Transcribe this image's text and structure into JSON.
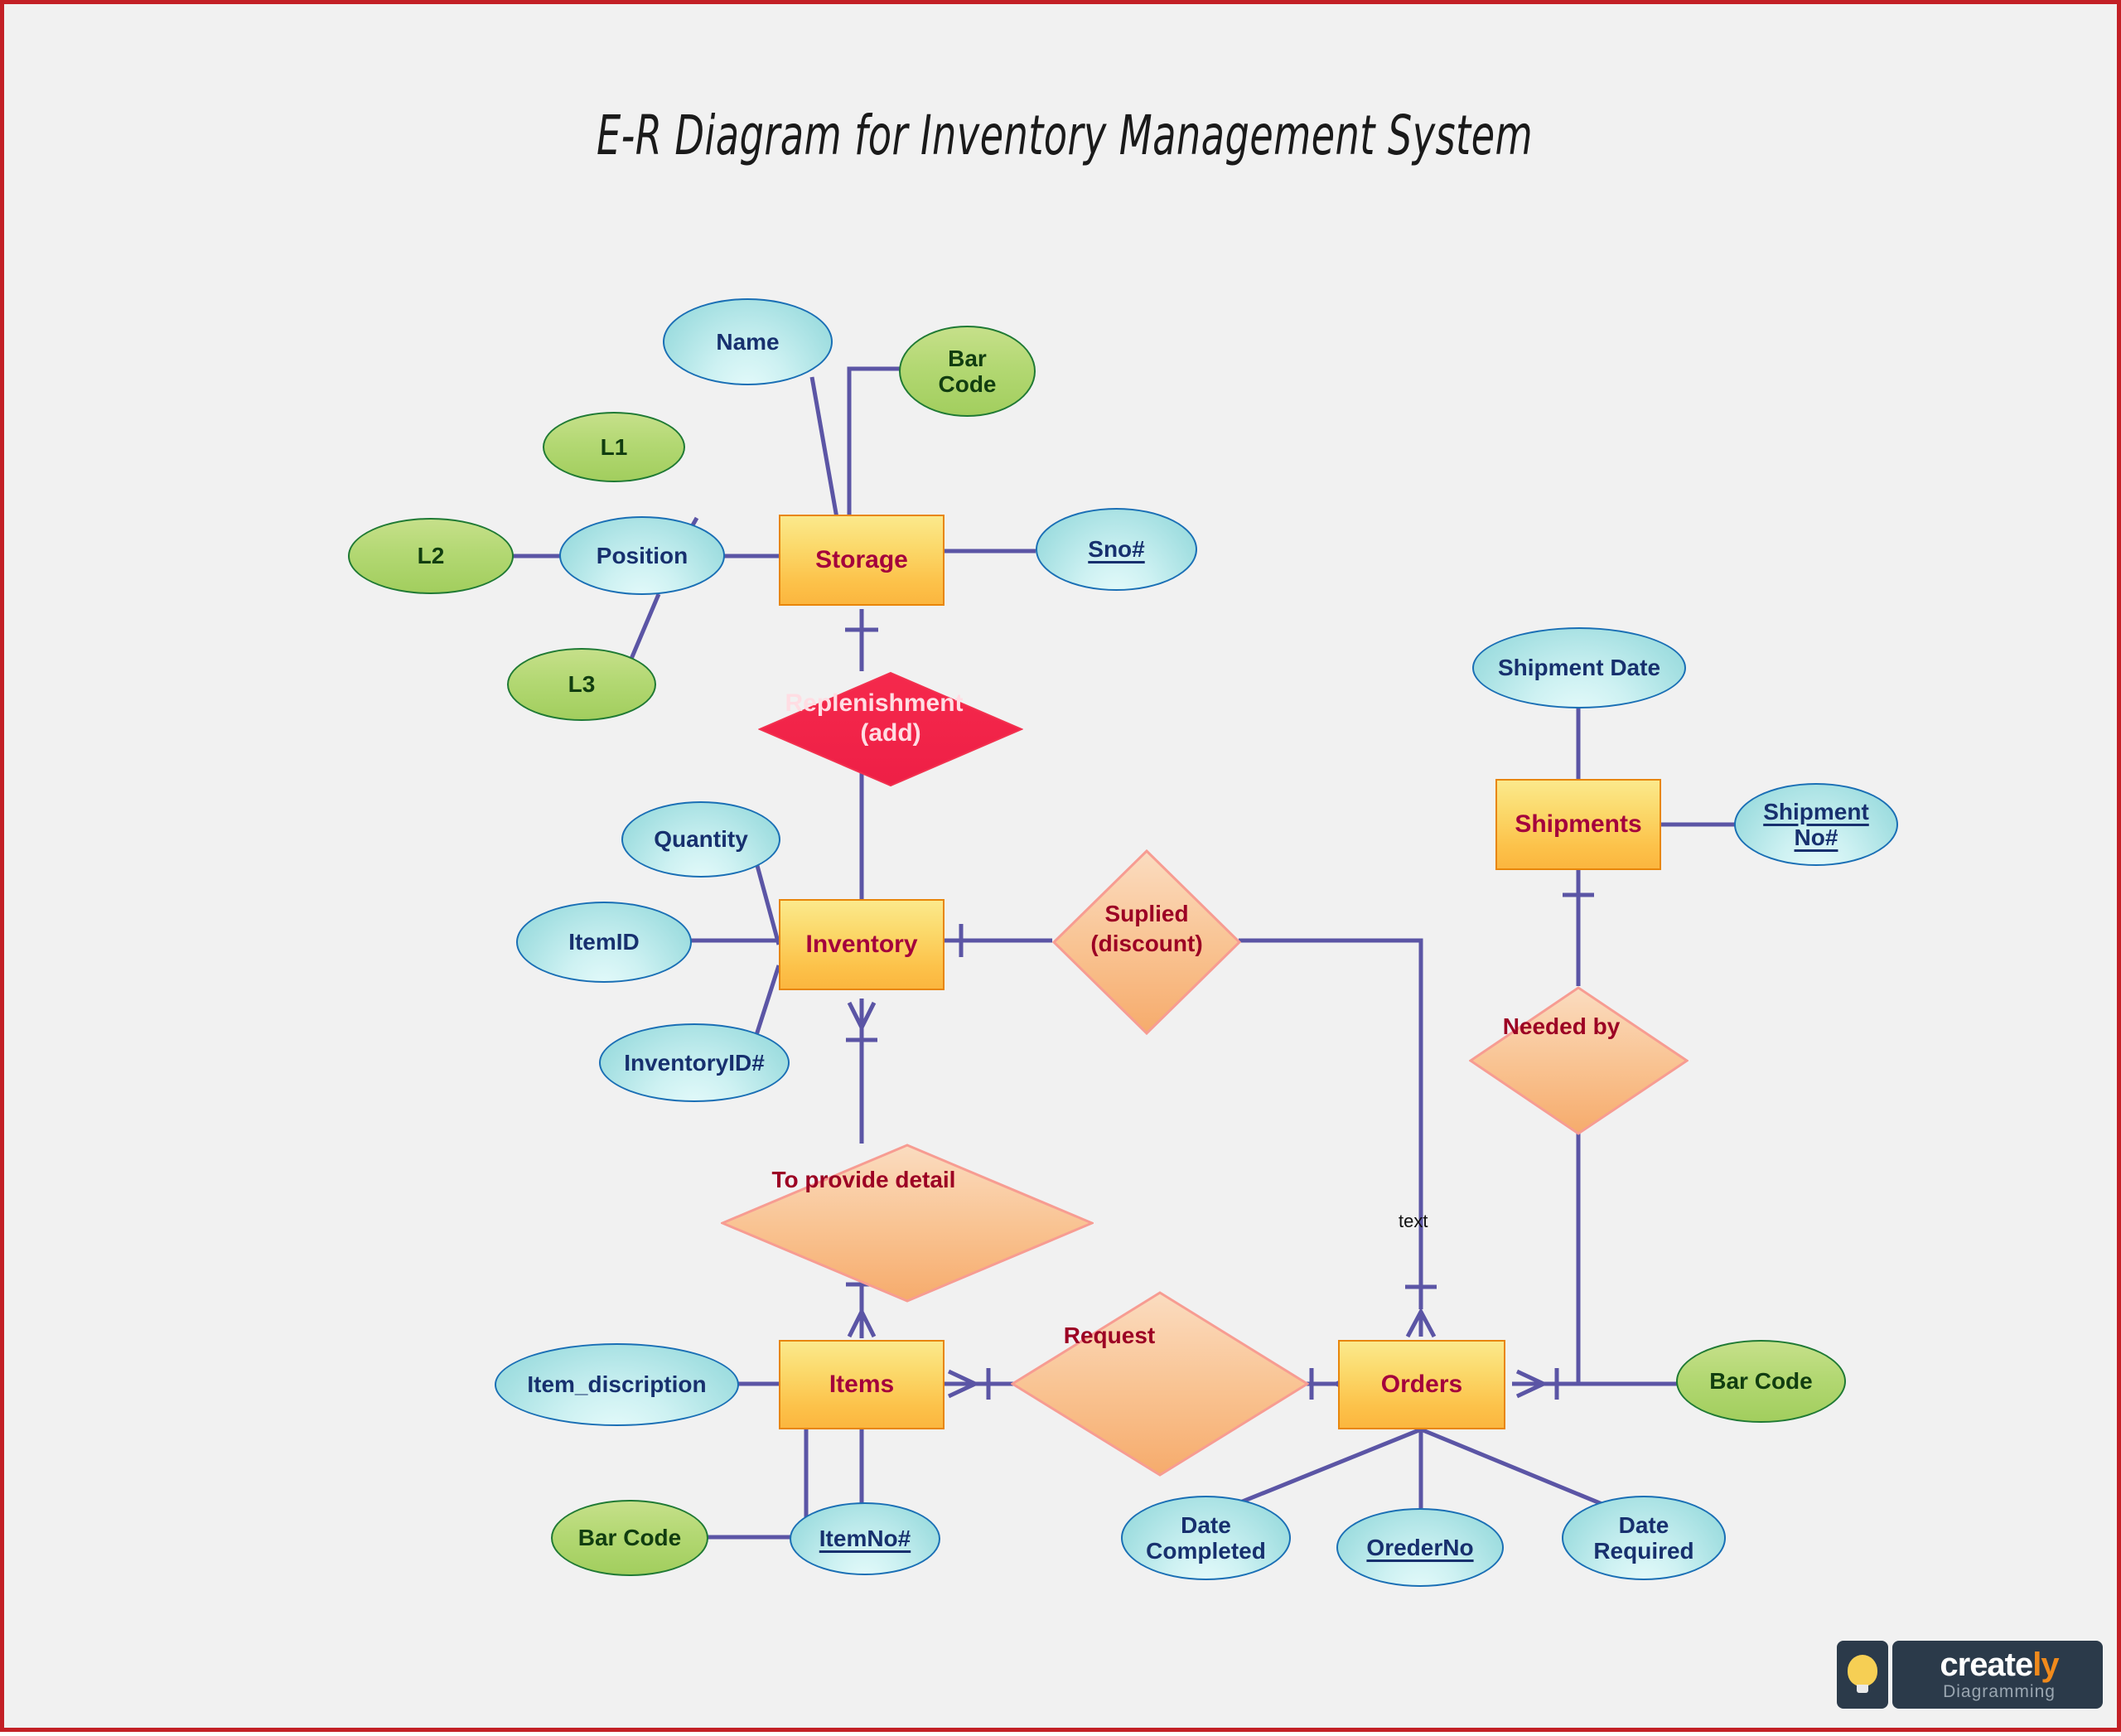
{
  "page": {
    "title": "E-R Diagram for Inventory Management System",
    "background_color": "#f1f1f1",
    "border_color": "#c32026"
  },
  "colors": {
    "entity_fill": "#fbc94e",
    "entity_border": "#e8860a",
    "entity_text": "#a4003c",
    "attribute_blue_fill": "#a8e2e4",
    "attribute_blue_border": "#1a6fb5",
    "attribute_blue_text": "#17306e",
    "attribute_green_fill": "#aed470",
    "attribute_green_border": "#1f7a34",
    "attribute_green_text": "#113d10",
    "relationship_peach_fill": "#f8c08a",
    "relationship_peach_border": "#f79c92",
    "relationship_peach_text": "#9c0024",
    "relationship_red_fill": "#f2314f",
    "relationship_red_text": "#ffdde3",
    "connector": "#5b55a5"
  },
  "entities": [
    {
      "id": "storage",
      "label": "Storage"
    },
    {
      "id": "inventory",
      "label": "Inventory"
    },
    {
      "id": "items",
      "label": "Items"
    },
    {
      "id": "orders",
      "label": "Orders"
    },
    {
      "id": "shipments",
      "label": "Shipments"
    }
  ],
  "relationships": [
    {
      "id": "replenishment",
      "label_line1": "Replenishment",
      "label_line2": "(add)",
      "style": "red"
    },
    {
      "id": "suplied",
      "label_line1": "Suplied",
      "label_line2": "(discount)",
      "style": "peach"
    },
    {
      "id": "provide-detail",
      "label_line1": "To provide detail",
      "label_line2": "",
      "style": "peach"
    },
    {
      "id": "request",
      "label_line1": "Request",
      "label_line2": "",
      "style": "peach"
    },
    {
      "id": "needed-by",
      "label_line1": "Needed by",
      "label_line2": "",
      "style": "peach"
    }
  ],
  "attributes": [
    {
      "id": "name",
      "label": "Name",
      "style": "blue",
      "key": false
    },
    {
      "id": "bar-code-storage",
      "label": "Bar\nCode",
      "style": "green",
      "key": false
    },
    {
      "id": "sno",
      "label": "Sno#",
      "style": "blue",
      "key": true
    },
    {
      "id": "position",
      "label": "Position",
      "style": "blue",
      "key": false
    },
    {
      "id": "l1",
      "label": "L1",
      "style": "green",
      "key": false
    },
    {
      "id": "l2",
      "label": "L2",
      "style": "green",
      "key": false
    },
    {
      "id": "l3",
      "label": "L3",
      "style": "green",
      "key": false
    },
    {
      "id": "quantity",
      "label": "Quantity",
      "style": "blue",
      "key": false
    },
    {
      "id": "item-id",
      "label": "ItemID",
      "style": "blue",
      "key": false
    },
    {
      "id": "inventory-id",
      "label": "InventoryID#",
      "style": "blue",
      "key": false
    },
    {
      "id": "item-discription",
      "label": "Item_discription",
      "style": "blue",
      "key": false
    },
    {
      "id": "bar-code-items",
      "label": "Bar Code",
      "style": "green",
      "key": false
    },
    {
      "id": "item-no",
      "label": "ItemNo#",
      "style": "blue",
      "key": true
    },
    {
      "id": "date-completed",
      "label": "Date\nCompleted",
      "style": "blue",
      "key": false
    },
    {
      "id": "oreder-no",
      "label": "OrederNo",
      "style": "blue",
      "key": true
    },
    {
      "id": "date-required",
      "label": "Date\nRequired",
      "style": "blue",
      "key": false
    },
    {
      "id": "bar-code-orders",
      "label": "Bar Code",
      "style": "green",
      "key": false
    },
    {
      "id": "shipment-date",
      "label": "Shipment Date",
      "style": "blue",
      "key": false
    },
    {
      "id": "shipment-no",
      "label": "Shipment\nNo#",
      "style": "blue",
      "key": true
    }
  ],
  "labels": {
    "edge_text": "text"
  },
  "logo": {
    "brand_white": "create",
    "brand_orange": "ly",
    "tagline": "Diagramming"
  },
  "node_text": {
    "storage": "Storage",
    "inventory": "Inventory",
    "items": "Items",
    "orders": "Orders",
    "shipments": "Shipments",
    "name": "Name",
    "bar_code_storage_l1": "Bar",
    "bar_code_storage_l2": "Code",
    "sno": "Sno#",
    "position": "Position",
    "l1": "L1",
    "l2": "L2",
    "l3": "L3",
    "quantity": "Quantity",
    "item_id": "ItemID",
    "inventory_id": "InventoryID#",
    "item_discription": "Item_discription",
    "bar_code_items": "Bar Code",
    "item_no": "ItemNo#",
    "date_completed_l1": "Date",
    "date_completed_l2": "Completed",
    "oreder_no": "OrederNo",
    "date_required_l1": "Date",
    "date_required_l2": "Required",
    "bar_code_orders": "Bar Code",
    "shipment_date": "Shipment Date",
    "shipment_no_l1": "Shipment",
    "shipment_no_l2": "No#",
    "replenishment_l1": "Replenishment",
    "replenishment_l2": "(add)",
    "suplied_l1": "Suplied",
    "suplied_l2": "(discount)",
    "provide_detail": "To provide detail",
    "request": "Request",
    "needed_by": "Needed by"
  }
}
